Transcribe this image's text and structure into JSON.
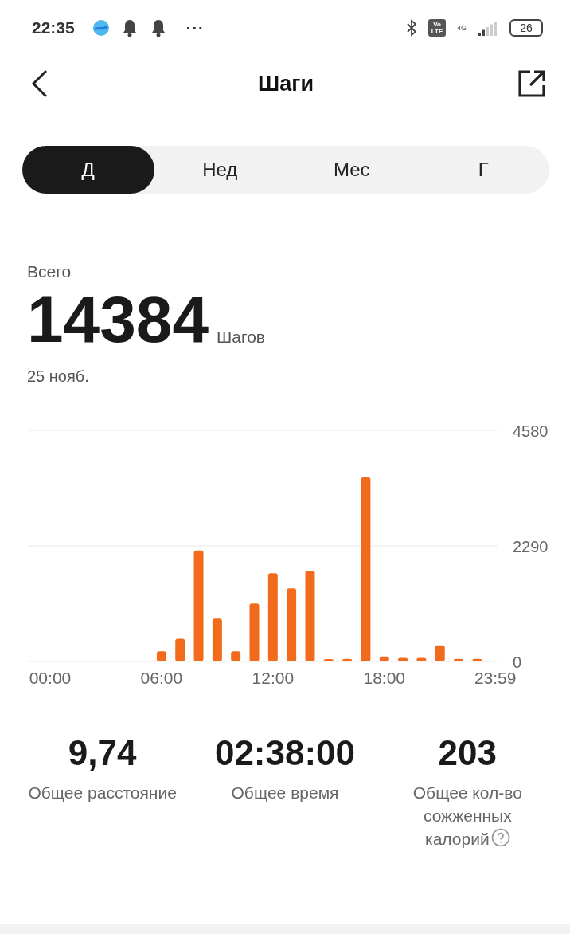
{
  "status_bar": {
    "time": "22:35",
    "battery": "26",
    "network": "4G",
    "volte": "Vo LTE",
    "more": "···"
  },
  "header": {
    "title": "Шаги"
  },
  "tabs": [
    {
      "label": "Д",
      "selected": true
    },
    {
      "label": "Нед",
      "selected": false
    },
    {
      "label": "Мес",
      "selected": false
    },
    {
      "label": "Г",
      "selected": false
    }
  ],
  "summary": {
    "label": "Всего",
    "value": "14384",
    "unit": "Шагов",
    "date": "25 нояб."
  },
  "chart_data": {
    "type": "bar",
    "x": [
      0,
      1,
      2,
      3,
      4,
      5,
      6,
      7,
      8,
      9,
      10,
      11,
      12,
      13,
      14,
      15,
      16,
      17,
      18,
      19,
      20,
      21,
      22,
      23
    ],
    "series": [
      {
        "color": "#f26b1d",
        "values": [
          0,
          0,
          0,
          0,
          0,
          0,
          200,
          450,
          2200,
          850,
          200,
          1150,
          1750,
          1450,
          1800,
          30,
          50,
          3650,
          100,
          70,
          70,
          320,
          50,
          50
        ]
      }
    ],
    "xlim": [
      -1.2,
      24.1
    ],
    "ylim": [
      0,
      4580
    ],
    "yticks": [
      0,
      2290,
      4580
    ],
    "xticks": [
      {
        "value": 0,
        "label": "00:00"
      },
      {
        "value": 6,
        "label": "06:00"
      },
      {
        "value": 12,
        "label": "12:00"
      },
      {
        "value": 18,
        "label": "18:00"
      },
      {
        "value": 23.98,
        "label": "23:59"
      }
    ]
  },
  "stats": [
    {
      "value": "9,74",
      "label": "Общее расстояние"
    },
    {
      "value": "02:38:00",
      "label": "Общее время"
    },
    {
      "value": "203",
      "label": "Общее кол-во сожженных калорий",
      "info": true
    }
  ]
}
